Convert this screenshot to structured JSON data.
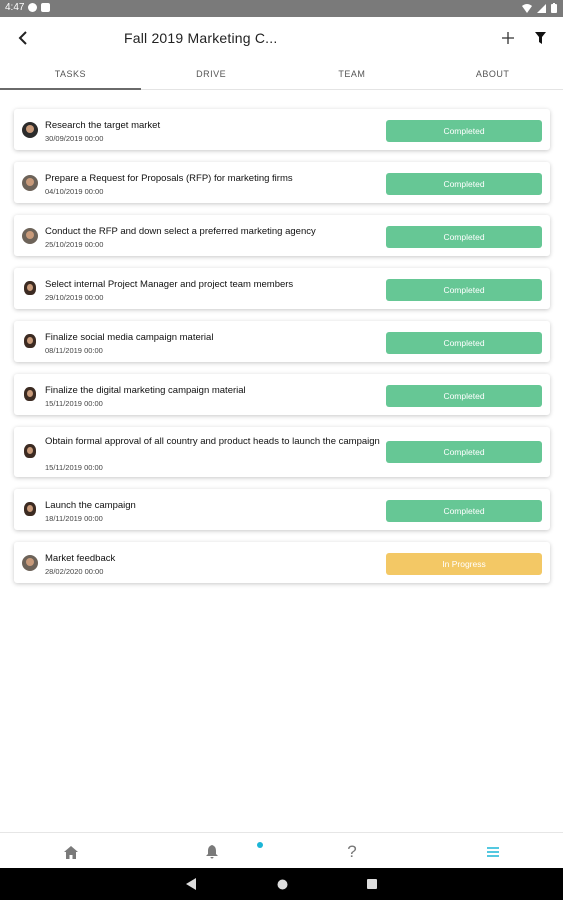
{
  "status_bar": {
    "time": "4:47"
  },
  "app_bar": {
    "title": "Fall 2019 Marketing C..."
  },
  "tabs": [
    {
      "label": "TASKS",
      "active": true
    },
    {
      "label": "DRIVE",
      "active": false
    },
    {
      "label": "TEAM",
      "active": false
    },
    {
      "label": "ABOUT",
      "active": false
    }
  ],
  "tasks": [
    {
      "title": "Research the target market",
      "date": "30/09/2019 00:00",
      "status": "Completed"
    },
    {
      "title": "Prepare a Request for Proposals (RFP) for marketing firms",
      "date": "04/10/2019 00:00",
      "status": "Completed"
    },
    {
      "title": "Conduct the RFP and down select a preferred marketing agency",
      "date": "25/10/2019 00:00",
      "status": "Completed"
    },
    {
      "title": "Select internal Project Manager and project team members",
      "date": "29/10/2019 00:00",
      "status": "Completed"
    },
    {
      "title": "Finalize social media campaign material",
      "date": "08/11/2019 00:00",
      "status": "Completed"
    },
    {
      "title": "Finalize the digital marketing campaign material",
      "date": "15/11/2019 00:00",
      "status": "Completed"
    },
    {
      "title": "Obtain formal approval of all country and product heads to launch the campaign",
      "date": "15/11/2019 00:00",
      "status": "Completed"
    },
    {
      "title": "Launch the campaign",
      "date": "18/11/2019 00:00",
      "status": "Completed"
    },
    {
      "title": "Market feedback",
      "date": "28/02/2020 00:00",
      "status": "In Progress"
    }
  ],
  "bottom_nav": {
    "help_glyph": "?"
  },
  "colors": {
    "completed": "#66c795",
    "in_progress": "#f3c865",
    "accent": "#1bb5d6",
    "status_bar": "#7a7a7a"
  },
  "icons": {
    "back": "arrow-left-icon",
    "add": "plus-icon",
    "filter": "filter-icon",
    "home": "home-icon",
    "notifications": "bell-icon",
    "help": "help-icon",
    "menu": "menu-icon"
  }
}
